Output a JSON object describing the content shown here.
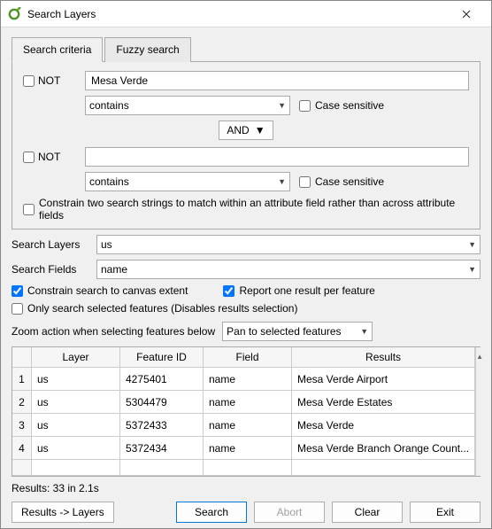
{
  "window": {
    "title": "Search Layers"
  },
  "tabs": {
    "criteria": "Search criteria",
    "fuzzy": "Fuzzy search"
  },
  "criteria": {
    "not_label": "NOT",
    "term1": "Mesa Verde",
    "op1": "contains",
    "case_label": "Case sensitive",
    "logic": "AND",
    "term2": "",
    "op2": "contains",
    "constrain_attr": "Constrain two search strings to match within an attribute field rather than across attribute fields"
  },
  "layers": {
    "label": "Search Layers",
    "value": "us"
  },
  "fields": {
    "label": "Search Fields",
    "value": "name"
  },
  "opts": {
    "constrain_canvas": "Constrain search to canvas extent",
    "report_one": "Report one result per feature",
    "only_selected": "Only search selected features (Disables results selection)"
  },
  "zoom": {
    "label": "Zoom action when selecting features below",
    "value": "Pan to selected features"
  },
  "table": {
    "headers": {
      "layer": "Layer",
      "fid": "Feature ID",
      "field": "Field",
      "results": "Results"
    },
    "rows": [
      {
        "n": "1",
        "layer": "us",
        "fid": "4275401",
        "field": "name",
        "result": "Mesa Verde Airport"
      },
      {
        "n": "2",
        "layer": "us",
        "fid": "5304479",
        "field": "name",
        "result": "Mesa Verde Estates"
      },
      {
        "n": "3",
        "layer": "us",
        "fid": "5372433",
        "field": "name",
        "result": "Mesa Verde"
      },
      {
        "n": "4",
        "layer": "us",
        "fid": "5372434",
        "field": "name",
        "result": "Mesa Verde Branch Orange Count..."
      }
    ]
  },
  "status": "Results: 33 in 2.1s",
  "buttons": {
    "results_layers": "Results -> Layers",
    "search": "Search",
    "abort": "Abort",
    "clear": "Clear",
    "exit": "Exit"
  }
}
